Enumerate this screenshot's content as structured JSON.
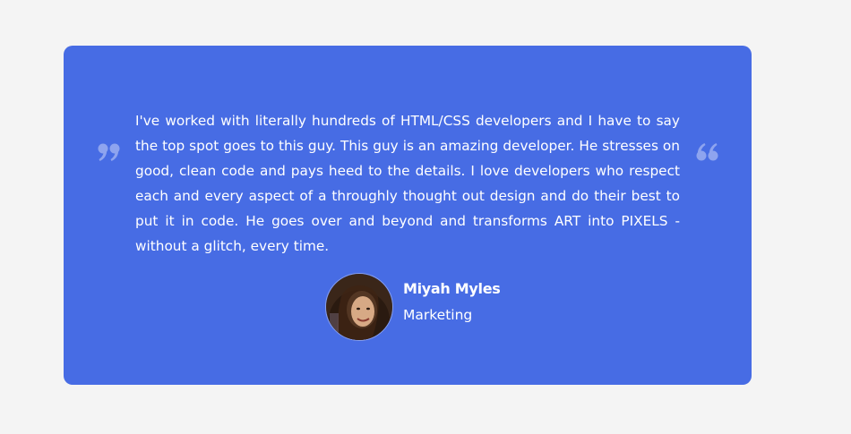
{
  "testimonial": {
    "text": "I've worked with literally hundreds of HTML/CSS developers and I have to say the top spot goes to this guy. This guy is an amazing developer. He stresses on good, clean code and pays heed to the details. I love developers who respect each and every aspect of a throughly thought out design and do their best to put it in code. He goes over and beyond and transforms ART into PIXELS - without a glitch, every time.",
    "author": {
      "name": "Miyah Myles",
      "role": "Marketing",
      "avatar_icon": "person-photo"
    },
    "left_icon": "closing-quote-icon",
    "right_icon": "opening-quote-icon"
  },
  "colors": {
    "background": "#f4f4f4",
    "card": "#476ce4",
    "text": "#ffffff",
    "quote_icon": "#8ea4ef"
  }
}
